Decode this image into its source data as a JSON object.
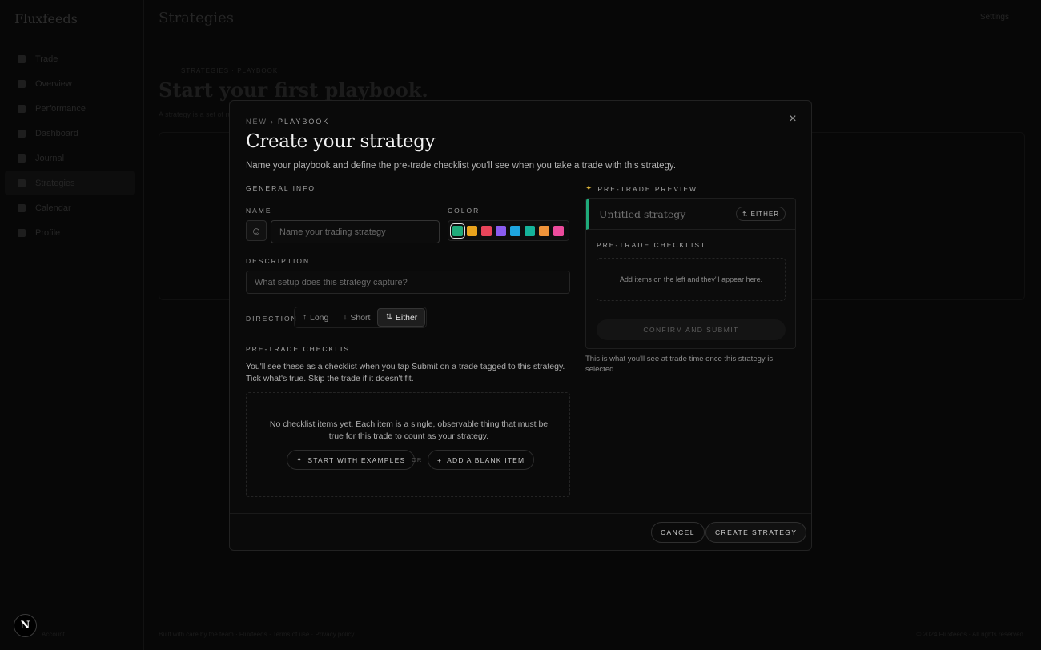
{
  "background": {
    "app_name": "Fluxfeeds",
    "page_title": "Strategies",
    "top_right": "Settings",
    "nav": [
      {
        "label": "Trade"
      },
      {
        "label": "Overview"
      },
      {
        "label": "Performance"
      },
      {
        "label": "Dashboard"
      },
      {
        "label": "Journal"
      },
      {
        "label": "Strategies"
      },
      {
        "label": "Calendar"
      },
      {
        "label": "Profile"
      }
    ],
    "breadcrumb": "STRATEGIES  ·  PLAYBOOK",
    "headline": "Start your first playbook.",
    "subline": "A strategy is a set of rules you follow on every trade.",
    "footer_left": "Built with care by the team · Fluxfeeds · Terms of use · Privacy policy",
    "footer_right": "© 2024 Fluxfeeds · All rights reserved",
    "footer_user": "Account"
  },
  "modal": {
    "eyebrow_new": "NEW",
    "eyebrow_sep": "›",
    "eyebrow_type": "PLAYBOOK",
    "title": "Create your strategy",
    "description": "Name your playbook and define the pre-trade checklist you'll see when you take a trade with this strategy.",
    "close_icon": "×",
    "general_info_label": "GENERAL INFO",
    "name_label": "NAME",
    "name_placeholder": "Name your trading strategy",
    "emoji_icon": "☺",
    "color_label": "COLOR",
    "colors": [
      {
        "name": "green",
        "hex": "#1faa7a",
        "selected": true
      },
      {
        "name": "amber",
        "hex": "#e8a21c",
        "selected": false
      },
      {
        "name": "red",
        "hex": "#e8455a",
        "selected": false
      },
      {
        "name": "violet",
        "hex": "#8a5cf0",
        "selected": false
      },
      {
        "name": "sky",
        "hex": "#1ea5e0",
        "selected": false
      },
      {
        "name": "teal",
        "hex": "#15b39a",
        "selected": false
      },
      {
        "name": "orange",
        "hex": "#f0943a",
        "selected": false
      },
      {
        "name": "pink",
        "hex": "#ec4b9c",
        "selected": false
      }
    ],
    "description_label": "DESCRIPTION",
    "description_placeholder": "What setup does this strategy capture?",
    "direction_label": "DIRECTION",
    "direction_options": [
      {
        "label": "Long",
        "icon": "↑",
        "active": false
      },
      {
        "label": "Short",
        "icon": "↓",
        "active": false
      },
      {
        "label": "Either",
        "icon": "⇅",
        "active": true
      }
    ],
    "checklist_label": "PRE-TRADE CHECKLIST",
    "checklist_help": "You'll see these as a checklist when you tap Submit on a trade tagged to this strategy. Tick what's true. Skip the trade if it doesn't fit.",
    "checklist_empty": "No checklist items yet. Each item is a single, observable thing that must be true for this trade to count as your strategy.",
    "start_examples_label": "START WITH EXAMPLES",
    "start_examples_icon": "✦",
    "or_label": "OR",
    "add_blank_label": "ADD A BLANK ITEM",
    "add_blank_icon": "+",
    "preview": {
      "label": "PRE-TRADE PREVIEW",
      "icon": "✦",
      "strategy_name": "Untitled strategy",
      "badge_icon": "⇅",
      "badge_label": "EITHER",
      "checklist_label": "PRE-TRADE CHECKLIST",
      "empty_text": "Add items on the left and they'll appear here.",
      "confirm_label": "CONFIRM AND SUBMIT",
      "note": "This is what you'll see at trade time once this strategy is selected.",
      "accent": "#1faa7a"
    },
    "cancel_label": "CANCEL",
    "create_label": "CREATE STRATEGY"
  },
  "next_badge": "N"
}
